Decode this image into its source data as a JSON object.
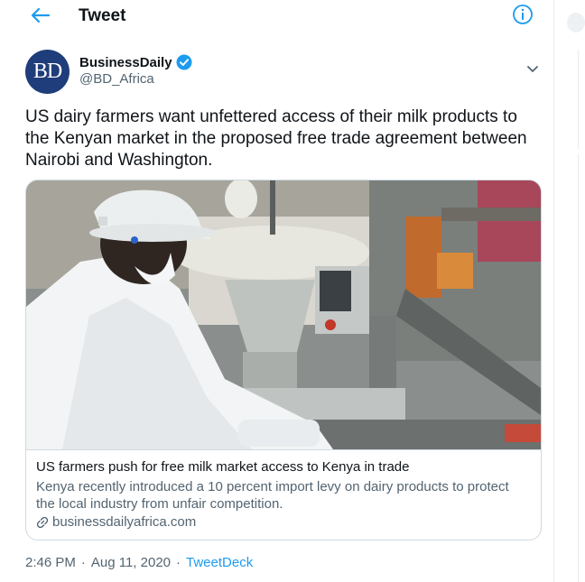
{
  "header": {
    "title": "Tweet",
    "back_icon": "arrow-left-icon",
    "info_icon": "info-icon"
  },
  "author": {
    "avatar_text": "BD",
    "name": "BusinessDaily",
    "handle": "@BD_Africa",
    "verified": true
  },
  "tweet": {
    "text": "US dairy farmers want unfettered access of their milk products to the Kenyan market in the proposed free trade agreement between Nairobi and Washington."
  },
  "card": {
    "title": "US farmers push for free milk market access to Kenya in trade",
    "description": "Kenya recently introduced a 10 percent import levy on dairy products to protect the local industry from unfair competition.",
    "domain": "businessdailyafrica.com"
  },
  "meta": {
    "time": "2:46 PM",
    "date": "Aug 11, 2020",
    "separator": "·",
    "source": "TweetDeck"
  },
  "colors": {
    "accent": "#1d9bf0",
    "text": "#0f1419",
    "muted": "#536471",
    "border": "#cfd9de",
    "avatar_bg": "#1f3d7a"
  }
}
